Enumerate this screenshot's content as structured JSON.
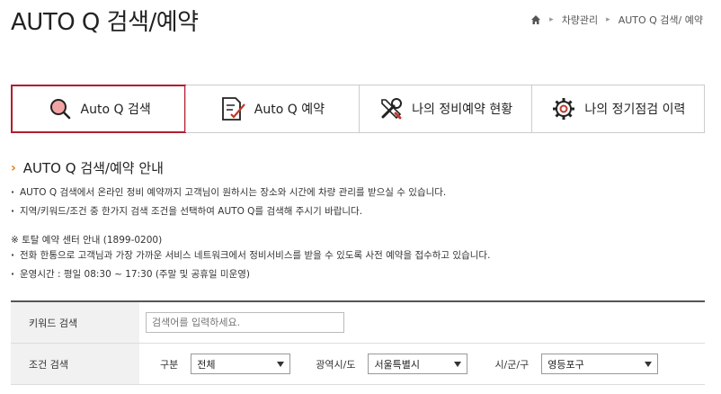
{
  "page": {
    "title": "AUTO Q 검색/예약"
  },
  "breadcrumb": {
    "home_icon": "home-icon",
    "items": [
      "차량관리",
      "AUTO Q 검색/ 예약"
    ]
  },
  "tabs": [
    {
      "label": "Auto Q 검색",
      "icon": "search-icon",
      "active": true
    },
    {
      "label": "Auto Q 예약",
      "icon": "document-edit-icon",
      "active": false
    },
    {
      "label": "나의 정비예약 현황",
      "icon": "tools-icon",
      "active": false
    },
    {
      "label": "나의 정기점검 이력",
      "icon": "gear-icon",
      "active": false
    }
  ],
  "guide": {
    "title": "AUTO Q 검색/예약 안내",
    "notes": [
      "AUTO Q 검색에서 온라인 정비 예약까지 고객님이 원하시는 장소와 시간에 차량 관리를 받으실 수 있습니다.",
      "지역/키워드/조건 중 한가지 검색 조건을 선택하여 AUTO Q를 검색해 주시기 바랍니다."
    ],
    "center_title": "※ 토탈 예약 센터 안내 (1899-0200)",
    "center_notes": [
      "전화 한통으로 고객님과 가장 가까운 서비스 네트워크에서 정비서비스를 받을 수 있도록 사전 예약을 접수하고 있습니다.",
      "운영시간 : 평일 08:30 ~ 17:30 (주말 및 공휴일 미운영)"
    ]
  },
  "search": {
    "keyword_label": "키워드 검색",
    "keyword_placeholder": "검색어를 입력하세요.",
    "condition_label": "조건 검색",
    "conditions": [
      {
        "label": "구분",
        "value": "전체"
      },
      {
        "label": "광역시/도",
        "value": "서울특별시"
      },
      {
        "label": "시/군/구",
        "value": "영등포구"
      }
    ]
  },
  "colors": {
    "accent": "#b01e2f",
    "chevron": "#e07b1f"
  }
}
